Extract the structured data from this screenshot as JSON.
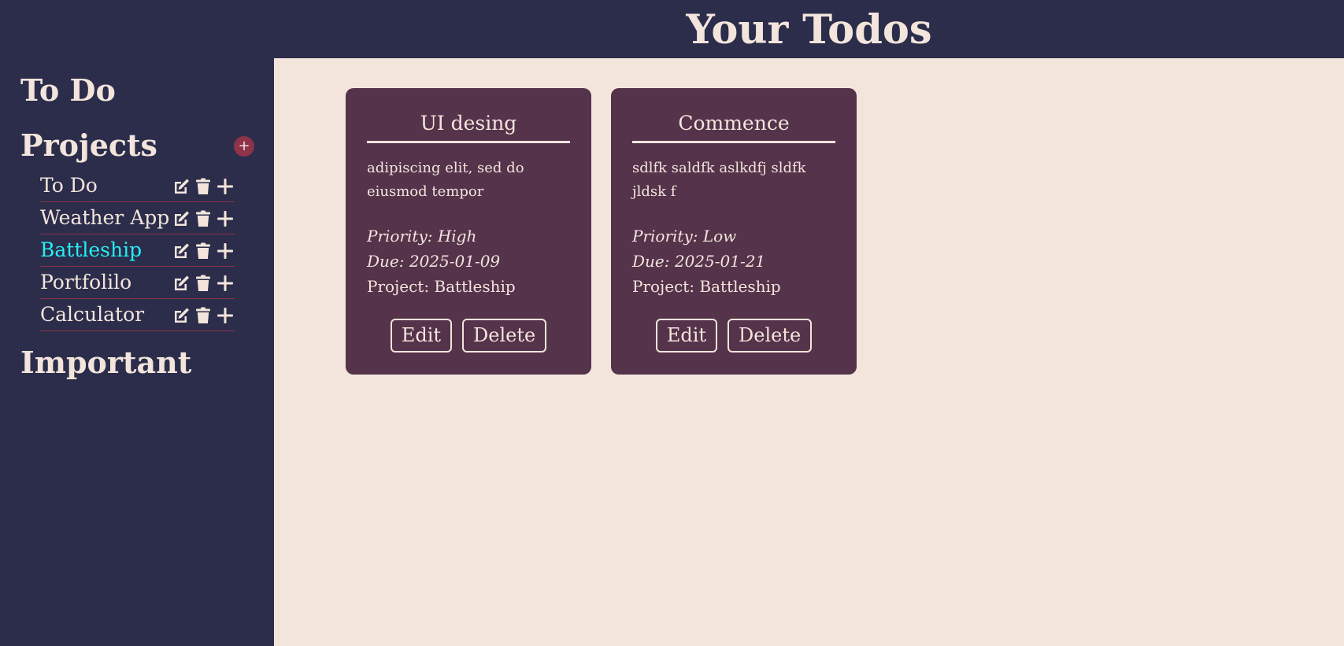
{
  "header": {
    "title": "Your Todos"
  },
  "sidebar": {
    "todo_heading": "To Do",
    "projects_heading": "Projects",
    "add_project_label": "+",
    "important_heading": "Important",
    "projects": [
      {
        "label": "To Do"
      },
      {
        "label": "Weather App"
      },
      {
        "label": "Battleship",
        "active": true
      },
      {
        "label": "Portfolilo"
      },
      {
        "label": "Calculator"
      }
    ]
  },
  "todos": [
    {
      "title": "UI desing",
      "description": "adipiscing elit, sed do eiusmod tempor",
      "priority": "Priority: High",
      "due": "Due: 2025-01-09",
      "project": "Project: Battleship",
      "edit_label": "Edit",
      "delete_label": "Delete"
    },
    {
      "title": "Commence",
      "description": "sdlfk saldfk aslkdfj sldfk jldsk f",
      "priority": "Priority: Low",
      "due": "Due: 2025-01-21",
      "project": "Project: Battleship",
      "edit_label": "Edit",
      "delete_label": "Delete"
    }
  ],
  "colors": {
    "background": "#f3e5dc",
    "sidebar": "#2b2d4b",
    "card": "#55334b",
    "accent": "#8e3349",
    "active_project": "#27eef2"
  }
}
